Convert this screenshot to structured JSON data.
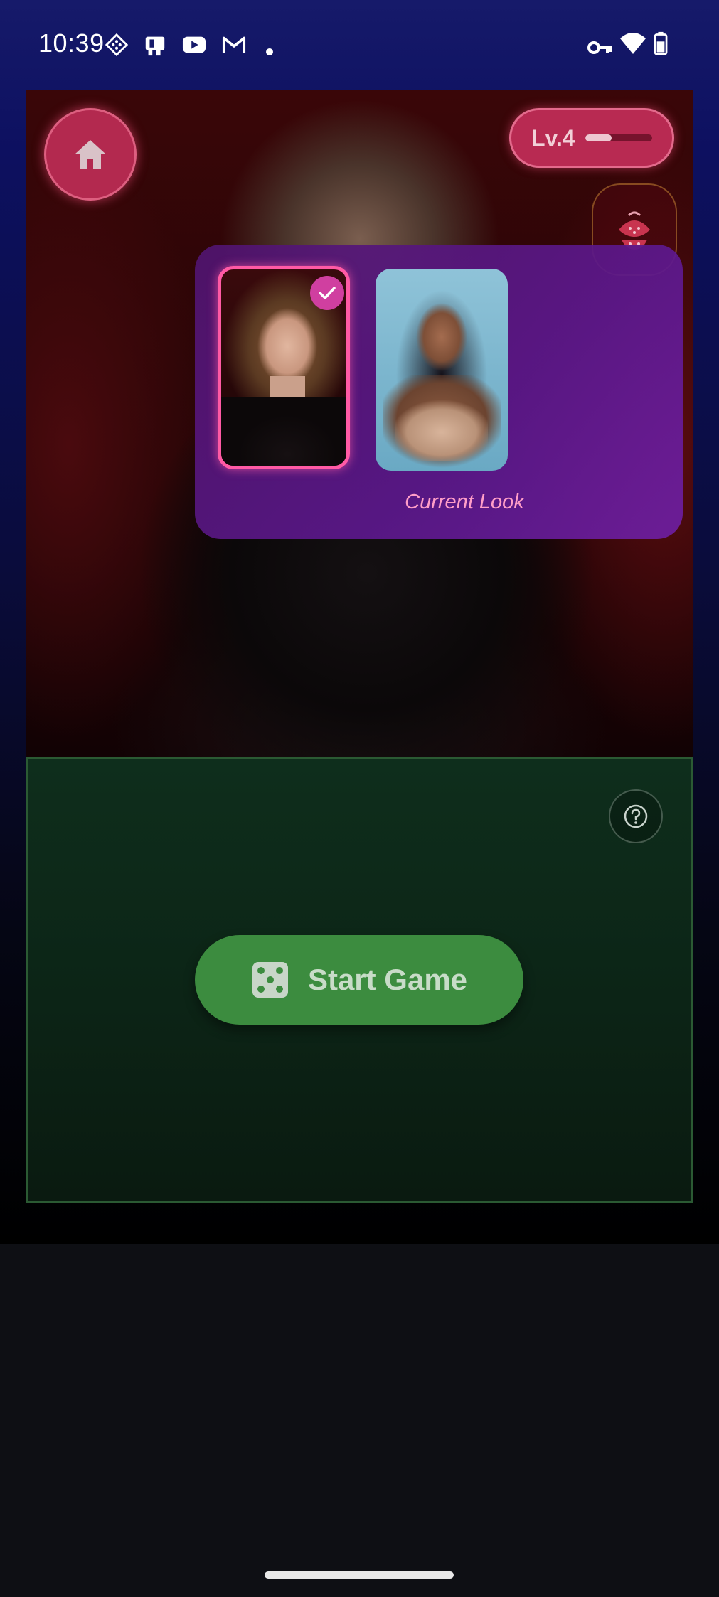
{
  "status_bar": {
    "time": "10:39",
    "left_icons": [
      "diamond-app-icon",
      "news-icon",
      "youtube-icon",
      "gmail-icon",
      "dot-icon"
    ],
    "right_icons": [
      "vpn-key-icon",
      "wifi-icon",
      "battery-icon"
    ]
  },
  "header": {
    "level_label": "Lv.4",
    "level_progress": 0.4
  },
  "look_selector": {
    "label": "Current Look",
    "selected_index": 0,
    "options_count": 2
  },
  "game": {
    "start_label": "Start Game"
  },
  "colors": {
    "accent_pink": "#b82a52",
    "selected_border": "#ff5aa5",
    "start_button": "#3c8c3f",
    "panel_purple": "#5c188c"
  }
}
